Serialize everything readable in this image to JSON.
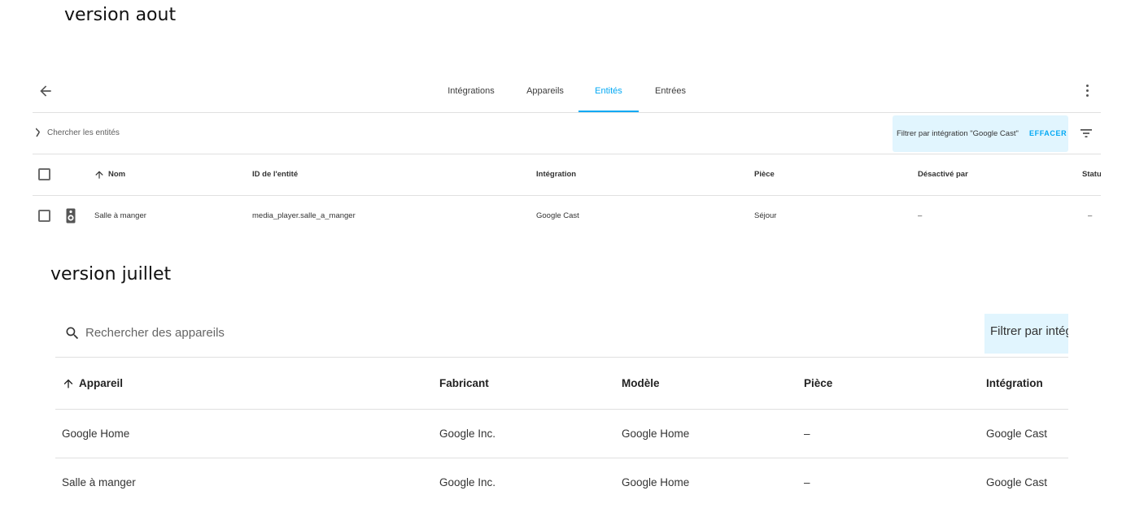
{
  "captions": {
    "august": "version aout",
    "july": "version juillet"
  },
  "august": {
    "tabs": [
      {
        "label": "Intégrations",
        "active": false
      },
      {
        "label": "Appareils",
        "active": false
      },
      {
        "label": "Entités",
        "active": true
      },
      {
        "label": "Entrées",
        "active": false
      }
    ],
    "search": {
      "placeholder": "Chercher les entités",
      "value": ""
    },
    "filter": {
      "label": "Filtrer par intégration \"Google Cast\"",
      "clear_label": "EFFACER"
    },
    "table": {
      "columns": [
        "Nom",
        "ID de l'entité",
        "Intégration",
        "Pièce",
        "Désactivé par",
        "Statu"
      ],
      "rows": [
        {
          "icon": "speaker-icon",
          "name": "Salle à manger",
          "entity_id": "media_player.salle_a_manger",
          "integration": "Google Cast",
          "room": "Séjour",
          "disabled_by": "–",
          "status": "–"
        }
      ]
    }
  },
  "july": {
    "search": {
      "placeholder": "Rechercher des appareils",
      "value": ""
    },
    "filter": {
      "label": "Filtrer par intégration"
    },
    "table": {
      "columns": [
        "Appareil",
        "Fabricant",
        "Modèle",
        "Pièce",
        "Intégration"
      ],
      "rows": [
        {
          "device": "Google Home",
          "manufacturer": "Google Inc.",
          "model": "Google Home",
          "room": "–",
          "integration": "Google Cast"
        },
        {
          "device": "Salle à manger",
          "manufacturer": "Google Inc.",
          "model": "Google Home",
          "room": "–",
          "integration": "Google Cast"
        }
      ]
    }
  },
  "colors": {
    "accent": "#03a9f4",
    "chip_background": "#e1f5fe",
    "divider": "#e0e0e0"
  }
}
